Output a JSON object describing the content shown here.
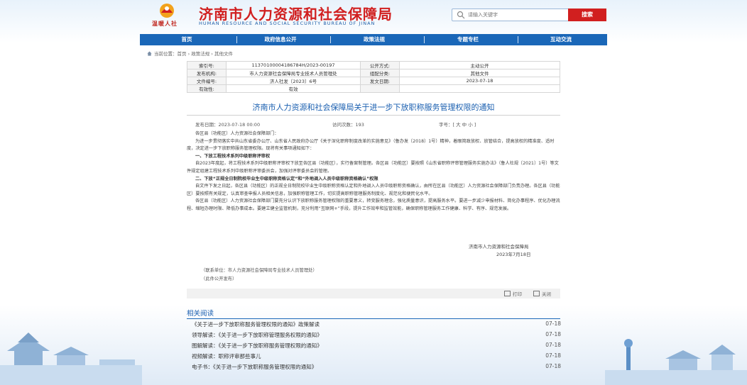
{
  "header": {
    "logo_text": "温暖人社",
    "site_title": "济南市人力资源和社会保障局",
    "site_subtitle": "HUMAN RESOURCE AND SOCIAL SECURITY BUREAU OF JINAN",
    "search_placeholder": "请输入关键字",
    "search_button": "搜索"
  },
  "nav": [
    "首页",
    "政府信息公开",
    "政策法规",
    "专题专栏",
    "互动交流"
  ],
  "breadcrumb": "当前位置：首页 › 政策法规 › 其他文件",
  "meta": {
    "index_label": "索引号:",
    "index_value": "11370100004186784H/2023-00197",
    "mode_label": "公开方式:",
    "mode_value": "主动公开",
    "org_label": "发布机构:",
    "org_value": "市人力资源社会保障局专业技术人员管理处",
    "cat_label": "组配分类:",
    "cat_value": "其他文件",
    "docno_label": "文件编号:",
    "docno_value": "济人社发〔2023〕6号",
    "date_label": "发文日期:",
    "date_value": "2023-07-18",
    "valid_label": "有效性:",
    "valid_value": "有效"
  },
  "doc": {
    "title": "济南市人力资源和社会保障局关于进一步下放职称服务管理权限的通知",
    "publish_date": "发布日期：2023-07-18 00:00",
    "views": "访问次数：193",
    "font_size": "字号：[ 大 中 小 ]"
  },
  "body": {
    "salutation": "各区县（功能区）人力资源社会保障部门：",
    "p1": "为进一步贯彻落实中共山东省委办公厅、山东省人民政府办公厅《关于深化职称制度改革的实施意见》（鲁办发〔2018〕1号）精神，着眼简政放权、放管结合，提高放权的精准度、适时度，决定进一步下放职称服务管理权限。现将有关事项通知如下：",
    "h1": "一、下放工程技术系列中级职称评审权",
    "p2": "自2023年度起，将工程技术系列中级职称评审权下放至各区县（功能区），实行备案制管理。各区县（功能区）要按照《山东省职称评审管理服务实施办法》（鲁人社规〔2021〕1号）等文件规定组建工程技术系列中级职称评审委员会，加强对评审委员会的管理。",
    "h2": "二、下放“正规全日制院校毕业生中级职称资格认定”和“外地调入人员中级职称资格确认”权限",
    "p3": "自文件下发之日起，各区县（功能区）的正规全日制院校毕业生中级职称资格认定和外地调入人员中级职称资格确认，由所在区县（功能区）人力资源社会保障部门负责办理。各区县（功能区）要按照有关规定，认真审查申报人员相关信息，加强职称管理工作，切实提高职称管理服务制度化、规范化和便民化水平。",
    "p4": "各区县（功能区）人力资源社会保障部门要充分认识下放职称服务管理权限的重要意义，转变服务理念，强化质量意识，提高服务水平。要进一步减少申报材料、简化办事程序、优化办理流程、缩短办理时限、降低办事成本。要建立健全监管机制，充分利用“互联网+”手段，提升工作效率和监管效能，确保职称管理服务工作健康、科学、有序、规范发展。",
    "sign_org": "济南市人力资源和社会保障局",
    "sign_date": "2023年7月18日",
    "contact": "（联系单位：市人力资源社会保障局专业技术人员管理处）",
    "publish_note": "（此件公开发布）"
  },
  "actions": {
    "print": "打印",
    "close": "关闭"
  },
  "related": {
    "title": "相关阅读",
    "items": [
      {
        "text": "《关于进一步下放职称服务管理权限的通知》政策解读",
        "date": "07-18"
      },
      {
        "text": "领导解读：《关于进一步下放职称管理服务权限的通知》",
        "date": "07-18"
      },
      {
        "text": "图解解读：《关于进一步下放职称服务管理权限的通知》",
        "date": "07-18"
      },
      {
        "text": "视频解读：职称评审那些事儿",
        "date": "07-18"
      },
      {
        "text": "电子书：《关于进一步下放职称服务管理权限的通知》",
        "date": "07-18"
      }
    ]
  }
}
